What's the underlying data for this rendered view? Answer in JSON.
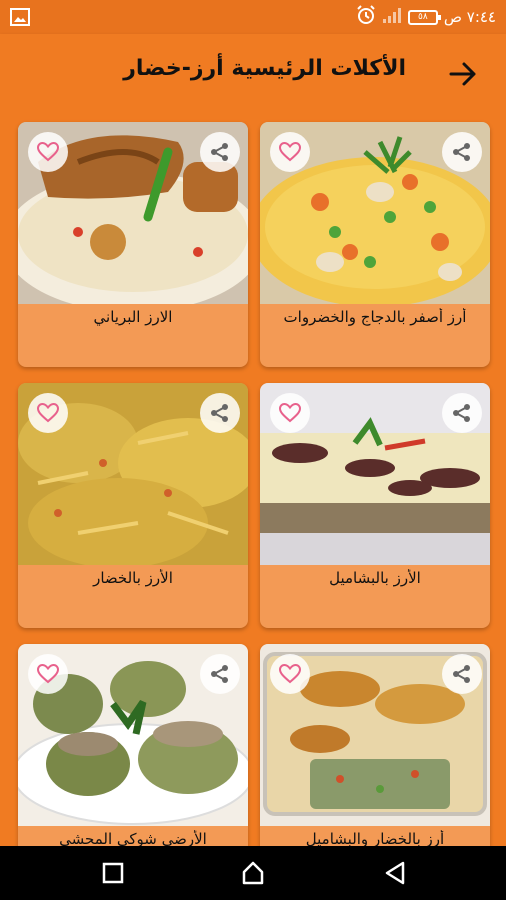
{
  "status_bar": {
    "time": "٧:٤٤ ص",
    "battery": "٥٨",
    "icons": [
      "gallery-icon",
      "alarm-icon",
      "signal-icon",
      "battery-icon"
    ]
  },
  "app_bar": {
    "title": "الأكلات الرئيسية أرز-خضار",
    "back_icon": "arrow-right-icon"
  },
  "dishes": [
    {
      "title": "أرز أصفر بالدجاج والخضروات"
    },
    {
      "title": "الارز البرياني"
    },
    {
      "title": "الأرز بالبشاميل"
    },
    {
      "title": "الأرز بالخضار"
    },
    {
      "title": "أرز بالخضار والبشاميل"
    },
    {
      "title": "الأرضي شوكي المحشي"
    }
  ],
  "card_icons": {
    "favorite": "heart-icon",
    "share": "share-icon"
  },
  "navigation": {
    "back": "triangle-back-icon",
    "home": "home-icon",
    "recents": "square-recents-icon"
  },
  "colors": {
    "primary": "#F07B22",
    "card": "#F39A55",
    "heart": "#E8618C"
  }
}
